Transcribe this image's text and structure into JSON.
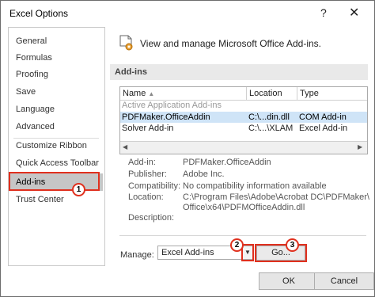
{
  "dialog": {
    "title": "Excel Options",
    "help": "?",
    "close": "✕"
  },
  "sidebar": {
    "items": [
      {
        "label": "General"
      },
      {
        "label": "Formulas"
      },
      {
        "label": "Proofing"
      },
      {
        "label": "Save"
      },
      {
        "label": "Language"
      },
      {
        "label": "Advanced"
      },
      {
        "label": "Customize Ribbon"
      },
      {
        "label": "Quick Access Toolbar"
      },
      {
        "label": "Add-ins"
      },
      {
        "label": "Trust Center"
      }
    ],
    "selected": "Add-ins"
  },
  "main": {
    "header": "View and manage Microsoft Office Add-ins.",
    "section": "Add-ins",
    "table": {
      "columns": [
        "Name",
        "Location",
        "Type"
      ],
      "group": "Active Application Add-ins",
      "rows": [
        {
          "name": "PDFMaker.OfficeAddin",
          "location": "C:\\...din.dll",
          "type": "COM Add-in"
        },
        {
          "name": "Solver Add-in",
          "location": "C:\\...\\XLAM",
          "type": "Excel Add-in"
        }
      ]
    },
    "details": {
      "addin_label": "Add-in:",
      "addin_value": "PDFMaker.OfficeAddin",
      "publisher_label": "Publisher:",
      "publisher_value": "Adobe Inc.",
      "compat_label": "Compatibility:",
      "compat_value": "No compatibility information available",
      "location_label": "Location:",
      "location_value_1": "C:\\Program Files\\Adobe\\Acrobat DC\\PDFMaker\\",
      "location_value_2": "Office\\x64\\PDFMOfficeAddin.dll",
      "description_label": "Description:"
    },
    "manage": {
      "label": "Manage:",
      "value": "Excel Add-ins",
      "go": "Go..."
    }
  },
  "footer": {
    "ok": "OK",
    "cancel": "Cancel"
  },
  "annotations": [
    "1",
    "2",
    "3"
  ],
  "colors": {
    "selected_bg": "#c6c6c6",
    "row_selected": "#cfe4f7",
    "highlight": "#e0301e"
  }
}
